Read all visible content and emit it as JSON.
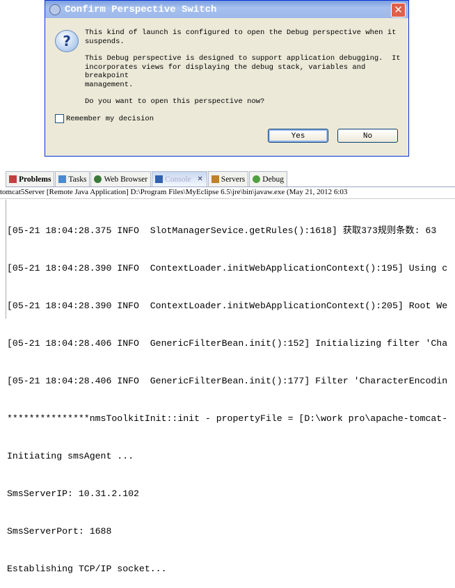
{
  "dialog": {
    "title": "Confirm Perspective Switch",
    "close": "✕",
    "icon": "?",
    "messages": [
      "This kind of launch is configured to open the Debug perspective when it\nsuspends.",
      "This Debug perspective is designed to support application debugging.  It\nincorporates views for displaying the debug stack, variables and breakpoint\nmanagement.",
      "Do you want to open this perspective now?"
    ],
    "remember": "Remember my decision",
    "yes": "Yes",
    "no": "No"
  },
  "tabs": [
    {
      "label": "Problems",
      "color": "#c04040"
    },
    {
      "label": "Tasks",
      "color": "#4a8ad0"
    },
    {
      "label": "Web Browser",
      "color": "#3a7a3a"
    },
    {
      "label": "Console",
      "color": "#3060b0"
    },
    {
      "label": "Servers",
      "color": "#c08030"
    },
    {
      "label": "Debug",
      "color": "#50a040"
    }
  ],
  "console_close": "✕",
  "console_header": "tomcat5Server [Remote Java Application] D:\\Program Files\\MyEclipse 6.5\\jre\\bin\\javaw.exe (May 21, 2012 6:03",
  "console_lines": [
    "[05-21 18:04:28.375 INFO  SlotManagerSevice.getRules():1618] 获取373规则条数: 63",
    "[05-21 18:04:28.390 INFO  ContextLoader.initWebApplicationContext():195] Using c",
    "[05-21 18:04:28.390 INFO  ContextLoader.initWebApplicationContext():205] Root We",
    "[05-21 18:04:28.406 INFO  GenericFilterBean.init():152] Initializing filter 'Cha",
    "[05-21 18:04:28.406 INFO  GenericFilterBean.init():177] Filter 'CharacterEncodin",
    "***************nmsToolkitInit::init - propertyFile = [D:\\work pro\\apache-tomcat-",
    "Initiating smsAgent ...",
    "SmsServerIP: 10.31.2.102",
    "SmsServerPort: 1688",
    "Establishing TCP/IP socket..."
  ]
}
